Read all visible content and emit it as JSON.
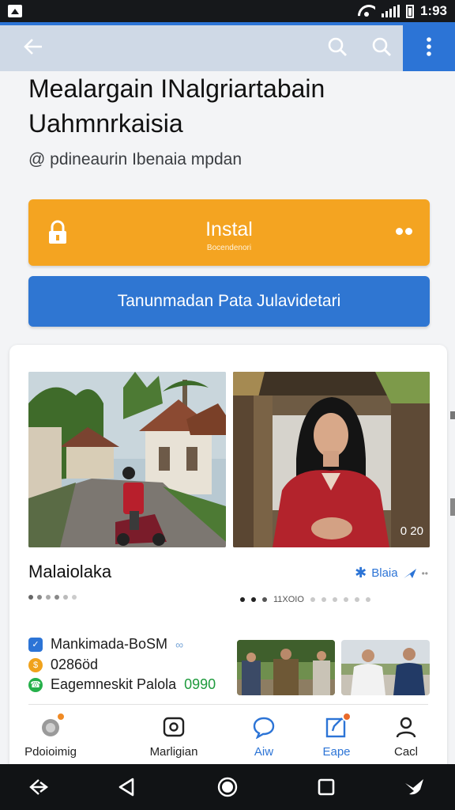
{
  "status_bar": {
    "time": "1:93"
  },
  "app_bar": {
    "back_icon": "arrow-left-icon",
    "action_icons": [
      "search-icon",
      "search-icon",
      "more-vert-icon"
    ],
    "accent": "#2c74d6"
  },
  "header": {
    "title": "Mealargain INalgriartabain Uahmnrkaisia",
    "subtitle": "@ pdineaurin Ibenaia mpdan"
  },
  "install_button": {
    "label": "Instal",
    "sub": "Bocendenori",
    "color": "#f4a421"
  },
  "secondary_button": {
    "label": "Tanunmadan Pata Julavidetari",
    "color": "#2f76d2"
  },
  "card": {
    "video_duration": "0 20",
    "section_title": "Malaiolaka",
    "share_label": "Blaia",
    "page_indicator": "11XOIO",
    "info_rows": [
      {
        "text": "Mankimada-BoSM",
        "icon": "verified-icon"
      },
      {
        "text": "0286öd",
        "icon": "coin-icon"
      },
      {
        "text": "Eagemneskit Palola",
        "highlight": "0990",
        "icon": "whatsapp-icon"
      }
    ]
  },
  "bottom_nav": {
    "tabs": [
      {
        "label": "Pdoioimig",
        "icon": "home-icon"
      },
      {
        "label": "Marligian",
        "icon": "camera-icon"
      },
      {
        "label": "Aiw",
        "icon": "chat-icon"
      },
      {
        "label": "Eape",
        "icon": "edit-icon"
      },
      {
        "label": "Cacl",
        "icon": "person-icon"
      }
    ]
  }
}
